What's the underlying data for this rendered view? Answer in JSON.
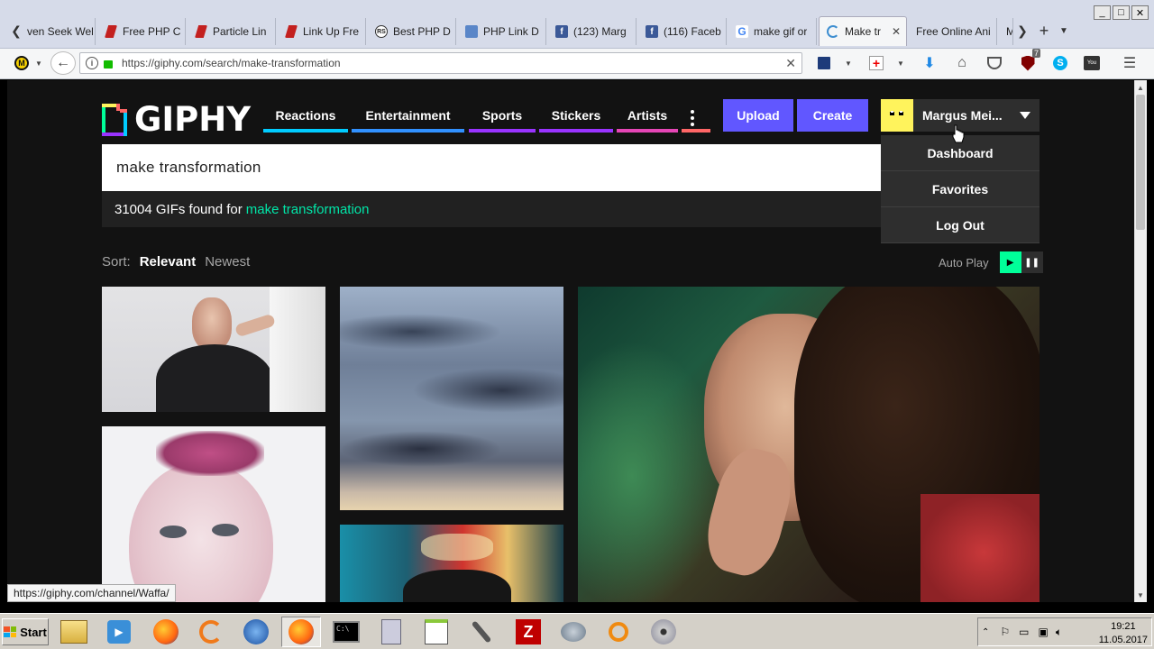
{
  "browser": {
    "tabs": [
      {
        "label": "ven Seek Wel",
        "icon": "none"
      },
      {
        "label": "Free PHP C",
        "icon": "red"
      },
      {
        "label": "Particle Lin",
        "icon": "red"
      },
      {
        "label": "Link Up Fre",
        "icon": "red"
      },
      {
        "label": "Best PHP D",
        "icon": "rs"
      },
      {
        "label": "PHP Link D",
        "icon": "blue"
      },
      {
        "label": "(123) Marg",
        "icon": "fb"
      },
      {
        "label": "(116) Faceb",
        "icon": "fb"
      },
      {
        "label": "make gif or",
        "icon": "g"
      },
      {
        "label": "Make tr",
        "icon": "spin",
        "active": true
      },
      {
        "label": "Free Online Ani",
        "icon": "none"
      },
      {
        "label": "M",
        "icon": "none"
      }
    ],
    "url": "https://giphy.com/search/make-transformation",
    "new_tab_glyph": "+",
    "ublock_badge": "7",
    "status_url": "https://giphy.com/channel/Waffa/"
  },
  "giphy": {
    "logo_text": "GIPHY",
    "nav": [
      {
        "label": "Reactions",
        "color": "#00ccff"
      },
      {
        "label": "Entertainment",
        "color": "#3191ff"
      },
      {
        "label": "Sports",
        "color": "#9933ff"
      },
      {
        "label": "Stickers",
        "color": "#9933ff"
      },
      {
        "label": "Artists",
        "color": "#e646b6"
      }
    ],
    "more_color": "#ff6666",
    "upload_label": "Upload",
    "create_label": "Create",
    "username": "Margus Mei...",
    "dropdown": [
      "Dashboard",
      "Favorites",
      "Log Out"
    ],
    "search_value": "make transformation",
    "results_count": "31004 GIFs found for",
    "results_term": "make transformation",
    "sort_label": "Sort:",
    "sort_relevant": "Relevant",
    "sort_newest": "Newest",
    "autoplay_label": "Auto Play",
    "accent_green": "#00ff99",
    "accent_purple": "#6157ff"
  },
  "taskbar": {
    "start_label": "Start",
    "time": "19:21",
    "date": "11.05.2017"
  }
}
